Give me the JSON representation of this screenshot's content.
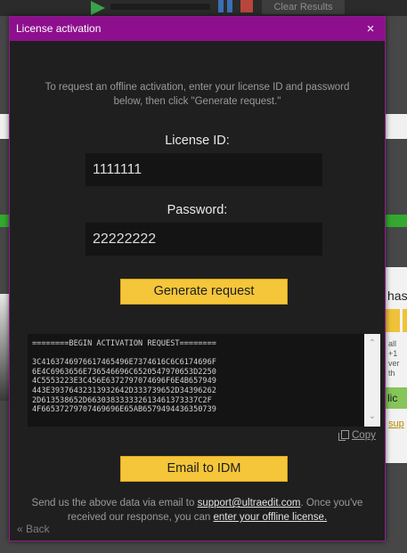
{
  "background": {
    "clear_results_label": "Clear Results",
    "right_panel_text": "has",
    "right_small_text_1": "all +1",
    "right_small_text_2": "ver th",
    "right_green_label": "lic",
    "right_link_text": "sup"
  },
  "dialog": {
    "title": "License activation",
    "close_icon": "×",
    "intro": "To request an offline activation, enter your license ID and password below, then click \"Generate request.\"",
    "license_id_label": "License ID:",
    "license_id_value": "1111111",
    "password_label": "Password:",
    "password_value": "22222222",
    "generate_button": "Generate request",
    "request_text": "========BEGIN ACTIVATION REQUEST========\n\n3C4163746976617465496E7374616C6C6174696F\n6E4C6963656E736546696C6520547970653D2250\n4C5553223E3C456E6372797074696F6E4B657949\n443E39376432313932642D333739652D34396262\n2D613538652D663038333332613461373337C2F\n4F66537279707469696E65AB6579494436350739",
    "copy_label": "Copy",
    "email_button": "Email to IDM",
    "footer_text_1": "Send us the above data via email to ",
    "footer_email": "support@ultraedit.com",
    "footer_text_2": ". Once you've received our response, you can ",
    "footer_link": "enter your offline license.",
    "back_label": "« Back",
    "scroll_up_icon": "⌃",
    "scroll_down_icon": "⌄"
  },
  "colors": {
    "titlebar": "#8e0f8e",
    "dialog_bg": "#1f1f1f",
    "button_yellow": "#f5c63a",
    "field_bg": "#141414"
  }
}
